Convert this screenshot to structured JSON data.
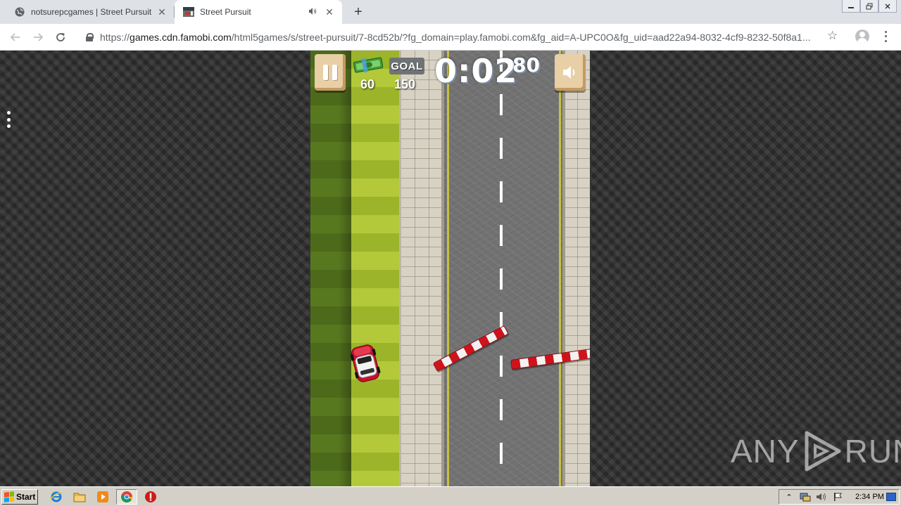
{
  "browser": {
    "tabs": [
      {
        "title": "notsurepcgames | Street Pursuit",
        "active": false,
        "favicon": "globe-icon"
      },
      {
        "title": "Street Pursuit",
        "active": true,
        "favicon": "game-thumbnail-icon",
        "audio": "speaker-icon"
      }
    ],
    "close_glyph": "✕",
    "new_tab_glyph": "+",
    "window_controls": [
      "minimize-icon",
      "restore-icon",
      "close-icon"
    ],
    "url_prefix": "https://",
    "url_host": "games.cdn.famobi.com",
    "url_path": "/html5games/s/street-pursuit/7-8cd52b/?fg_domain=play.famobi.com&fg_aid=A-UPC0O&fg_uid=aad22a94-8032-4cf9-8232-50f8a1..."
  },
  "game": {
    "cash": "60",
    "goal_label": "GOAL",
    "goal": "150",
    "timer_main": "0:02",
    "timer_fraction": "80",
    "icons": [
      "pause-icon",
      "cash-icon",
      "sound-icon",
      "player-car",
      "barrier"
    ]
  },
  "watermark": {
    "left": "ANY",
    "right": "RUN"
  },
  "taskbar": {
    "start_label": "Start",
    "pinned": [
      "ie-icon",
      "explorer-icon",
      "media-player-icon",
      "chrome-icon",
      "stop-icon"
    ],
    "clock": "2:34 PM"
  },
  "colors": {
    "chrome_bg": "#dee1e6",
    "page_bg": "#2e2e2e",
    "barrier_red": "#d0121b",
    "grass": "#b3c93a",
    "road": "#727272",
    "taskbar": "#d4d0c8"
  }
}
